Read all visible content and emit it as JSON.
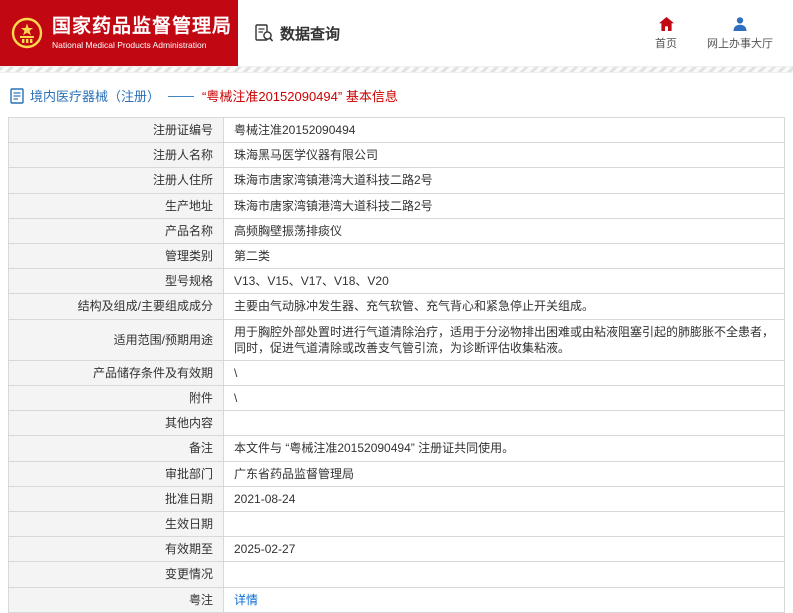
{
  "header": {
    "org_name": "国家药品监督管理局",
    "org_name_en": "National Medical Products Administration",
    "nav_title": "数据查询",
    "links": [
      {
        "label": "首页",
        "icon": "home-icon"
      },
      {
        "label": "网上办事大厅",
        "icon": "person-icon"
      }
    ]
  },
  "colors": {
    "brand_red": "#c00712",
    "title_blue": "#2a71b8",
    "highlight_red": "#cc0000",
    "link_blue": "#0a6cd6"
  },
  "breadcrumb": {
    "section": "境内医疗器械（注册）",
    "separator": "——",
    "highlight": "“粤械注准20152090494” 基本信息"
  },
  "table": {
    "rows": [
      {
        "label": "注册证编号",
        "value": "粤械注准20152090494"
      },
      {
        "label": "注册人名称",
        "value": "珠海黑马医学仪器有限公司"
      },
      {
        "label": "注册人住所",
        "value": "珠海市唐家湾镇港湾大道科技二路2号"
      },
      {
        "label": "生产地址",
        "value": "珠海市唐家湾镇港湾大道科技二路2号"
      },
      {
        "label": "产品名称",
        "value": "高频胸壁振荡排痰仪"
      },
      {
        "label": "管理类别",
        "value": "第二类"
      },
      {
        "label": "型号规格",
        "value": "V13、V15、V17、V18、V20"
      },
      {
        "label": "结构及组成/主要组成成分",
        "value": "主要由气动脉冲发生器、充气软管、充气背心和紧急停止开关组成。"
      },
      {
        "label": "适用范围/预期用途",
        "value": "用于胸腔外部处置时进行气道清除治疗，适用于分泌物排出困难或由粘液阻塞引起的肺膨胀不全患者，同时，促进气道清除或改善支气管引流，为诊断评估收集粘液。"
      },
      {
        "label": "产品储存条件及有效期",
        "value": "\\"
      },
      {
        "label": "附件",
        "value": "\\"
      },
      {
        "label": "其他内容",
        "value": ""
      },
      {
        "label": "备注",
        "value": "本文件与 “粤械注准20152090494” 注册证共同使用。"
      },
      {
        "label": "审批部门",
        "value": "广东省药品监督管理局"
      },
      {
        "label": "批准日期",
        "value": "2021-08-24"
      },
      {
        "label": "生效日期",
        "value": ""
      },
      {
        "label": "有效期至",
        "value": "2025-02-27"
      },
      {
        "label": "变更情况",
        "value": ""
      },
      {
        "label": "粤注",
        "value": "详情"
      }
    ]
  }
}
